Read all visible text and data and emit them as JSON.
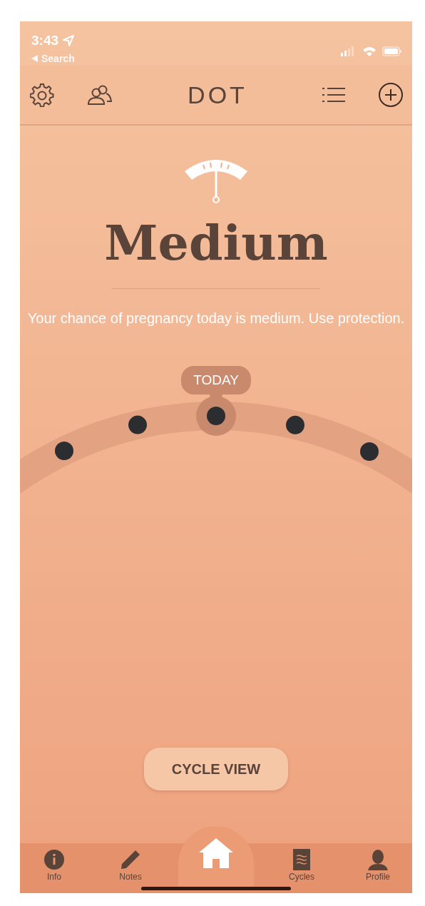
{
  "status_bar": {
    "time": "3:43",
    "back_label": "Search"
  },
  "header": {
    "title": "DOT"
  },
  "risk": {
    "level_label": "Medium",
    "message": "Your chance of pregnancy today is medium. Use protection."
  },
  "cycle_arc": {
    "today_label": "TODAY",
    "days": [
      {
        "selected": false
      },
      {
        "selected": false
      },
      {
        "selected": true
      },
      {
        "selected": false
      },
      {
        "selected": false
      }
    ]
  },
  "cycle_view_button": "CYCLE VIEW",
  "tabs": [
    {
      "kind": "info",
      "label": "Info",
      "selected": false
    },
    {
      "kind": "notes",
      "label": "Notes",
      "selected": false
    },
    {
      "kind": "home",
      "selected": true
    },
    {
      "kind": "cycles",
      "label": "Cycles",
      "selected": false
    },
    {
      "kind": "profile",
      "label": "Profile",
      "selected": false
    }
  ]
}
